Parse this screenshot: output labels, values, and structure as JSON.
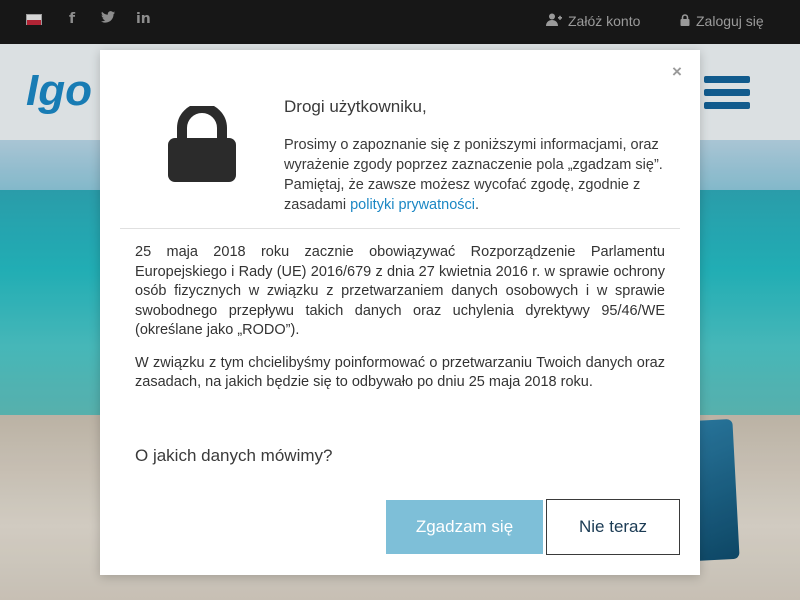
{
  "topbar": {
    "social": [
      "f",
      "t",
      "in"
    ],
    "register_label": "Załóż konto",
    "login_label": "Zaloguj się"
  },
  "background": {
    "logo_text": "Igo"
  },
  "modal": {
    "greeting": "Drogi użytkowniku,",
    "intro_text": "Prosimy o zapoznanie się z poniższymi informacjami, oraz wyrażenie zgody poprzez zaznaczenie pola „zgadzam się”. Pamiętaj, że zawsze możesz wycofać zgodę, zgodnie z zasadami ",
    "privacy_link": "polityki prywatności",
    "intro_end": ".",
    "paragraph1": "25 maja 2018 roku zacznie obowiązywać Rozporządzenie Parlamentu Europejskiego i Rady (UE) 2016/679 z dnia 27 kwietnia 2016 r. w sprawie ochrony osób fizycznych w związku z przetwarzaniem danych osobowych i w sprawie swobodnego przepływu takich danych oraz uchylenia dyrektywy 95/46/WE (określane jako „RODO”).",
    "paragraph2": "W związku z tym chcielibyśmy poinformować o przetwarzaniu Twoich danych oraz zasadach, na jakich będzie się to odbywało po dniu 25 maja 2018 roku.",
    "section_heading": "O jakich danych mówimy?",
    "agree_label": "Zgadzam się",
    "later_label": "Nie teraz",
    "close_symbol": "×"
  },
  "icons": {
    "lock": "lock-icon",
    "close": "close-icon",
    "user_plus": "user-plus-icon",
    "padlock_small": "lock-small-icon",
    "menu": "menu-icon"
  },
  "colors": {
    "accent": "#1b87c4",
    "agree_button": "#7ebfd8",
    "topbar": "#1a1a1a",
    "hamburger": "#13639a"
  }
}
